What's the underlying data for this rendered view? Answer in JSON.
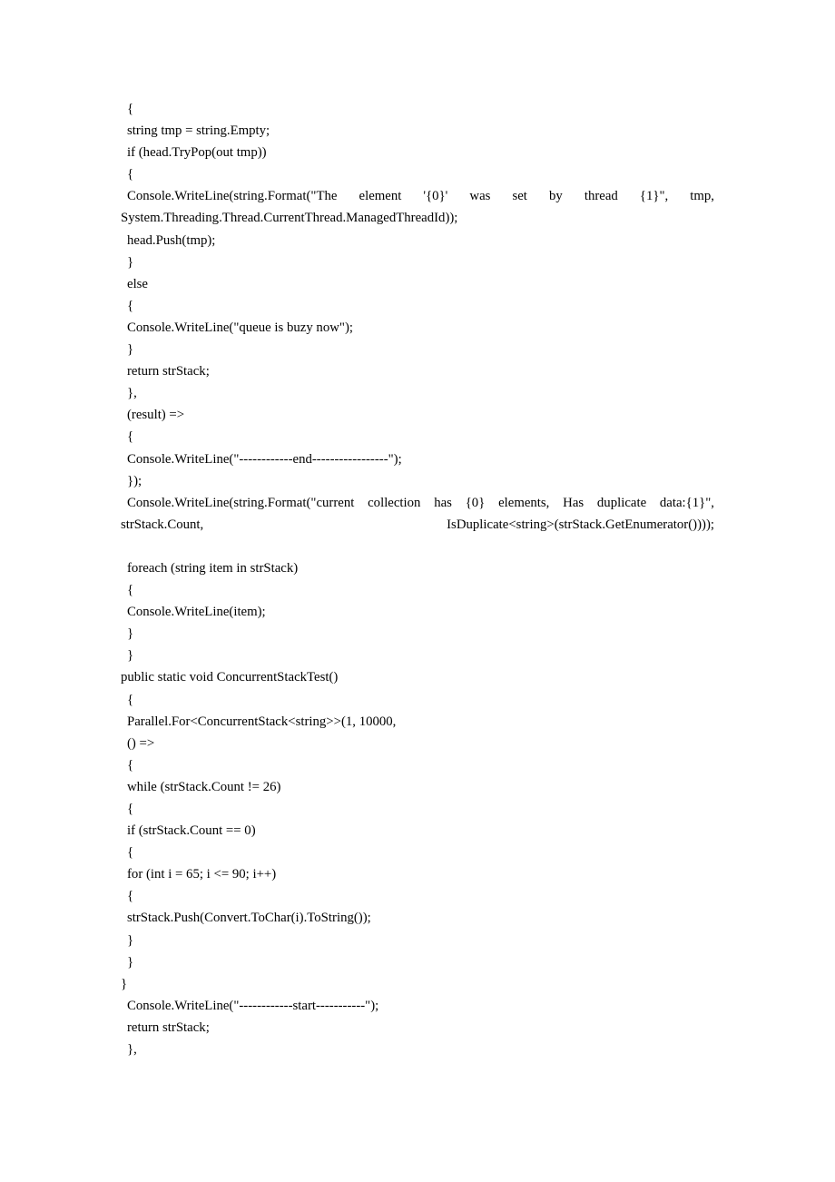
{
  "document": {
    "type": "code-listing",
    "language": "C#",
    "page_background": "#ffffff",
    "text_color": "#000000",
    "lines": [
      {
        "id": "l01",
        "indent": 1,
        "style": "plain",
        "text": "{"
      },
      {
        "id": "l02",
        "indent": 1,
        "style": "plain",
        "text": "string tmp = string.Empty;"
      },
      {
        "id": "l03",
        "indent": 1,
        "style": "plain",
        "text": "if (head.TryPop(out tmp))"
      },
      {
        "id": "l04",
        "indent": 1,
        "style": "plain",
        "text": "{"
      },
      {
        "id": "l05",
        "indent": 1,
        "style": "justify",
        "text": "Console.WriteLine(string.Format(\"The element '{0}' was set by thread {1}\", tmp, System.Threading.Thread.CurrentThread.ManagedThreadId));"
      },
      {
        "id": "l06",
        "indent": 1,
        "style": "plain",
        "text": "head.Push(tmp);"
      },
      {
        "id": "l07",
        "indent": 1,
        "style": "plain",
        "text": "}"
      },
      {
        "id": "l08",
        "indent": 1,
        "style": "plain",
        "text": "else"
      },
      {
        "id": "l09",
        "indent": 1,
        "style": "plain",
        "text": "{"
      },
      {
        "id": "l10",
        "indent": 1,
        "style": "plain",
        "text": "Console.WriteLine(\"queue is buzy now\");"
      },
      {
        "id": "l11",
        "indent": 1,
        "style": "plain",
        "text": "}"
      },
      {
        "id": "l12",
        "indent": 1,
        "style": "plain",
        "text": "return strStack;"
      },
      {
        "id": "l13",
        "indent": 1,
        "style": "plain",
        "text": "},"
      },
      {
        "id": "l14",
        "indent": 1,
        "style": "plain",
        "text": "(result) =>"
      },
      {
        "id": "l15",
        "indent": 1,
        "style": "plain",
        "text": "{"
      },
      {
        "id": "l16",
        "indent": 1,
        "style": "plain",
        "text": "Console.WriteLine(\"------------end-----------------\");"
      },
      {
        "id": "l17",
        "indent": 1,
        "style": "plain",
        "text": "});"
      },
      {
        "id": "l18",
        "indent": 1,
        "style": "justify",
        "text": "Console.WriteLine(string.Format(\"current collection has {0} elements, Has duplicate data:{1}\", strStack.Count, IsDuplicate<string>(strStack.GetEnumerator())));"
      },
      {
        "id": "l19",
        "indent": 0,
        "style": "blank",
        "text": ""
      },
      {
        "id": "l20",
        "indent": 1,
        "style": "plain",
        "text": "foreach (string item in strStack)"
      },
      {
        "id": "l21",
        "indent": 1,
        "style": "plain",
        "text": "{"
      },
      {
        "id": "l22",
        "indent": 1,
        "style": "plain",
        "text": "Console.WriteLine(item);"
      },
      {
        "id": "l23",
        "indent": 1,
        "style": "plain",
        "text": "}"
      },
      {
        "id": "l24",
        "indent": 1,
        "style": "plain",
        "text": "}"
      },
      {
        "id": "l25",
        "indent": 0,
        "style": "plain",
        "text": "public static void ConcurrentStackTest()"
      },
      {
        "id": "l26",
        "indent": 1,
        "style": "plain",
        "text": "{"
      },
      {
        "id": "l27",
        "indent": 1,
        "style": "plain",
        "text": "Parallel.For<ConcurrentStack<string>>(1, 10000,"
      },
      {
        "id": "l28",
        "indent": 1,
        "style": "plain",
        "text": "() =>"
      },
      {
        "id": "l29",
        "indent": 1,
        "style": "plain",
        "text": "{"
      },
      {
        "id": "l30",
        "indent": 1,
        "style": "plain",
        "text": "while (strStack.Count != 26)"
      },
      {
        "id": "l31",
        "indent": 1,
        "style": "plain",
        "text": "{"
      },
      {
        "id": "l32",
        "indent": 1,
        "style": "plain",
        "text": "if (strStack.Count == 0)"
      },
      {
        "id": "l33",
        "indent": 1,
        "style": "plain",
        "text": "{"
      },
      {
        "id": "l34",
        "indent": 1,
        "style": "plain",
        "text": "for (int i = 65; i <= 90; i++)"
      },
      {
        "id": "l35",
        "indent": 1,
        "style": "plain",
        "text": "{"
      },
      {
        "id": "l36",
        "indent": 1,
        "style": "plain",
        "text": "strStack.Push(Convert.ToChar(i).ToString());"
      },
      {
        "id": "l37",
        "indent": 1,
        "style": "plain",
        "text": "}"
      },
      {
        "id": "l38",
        "indent": 1,
        "style": "plain",
        "text": "}"
      },
      {
        "id": "l39",
        "indent": 0,
        "style": "plain",
        "text": "}"
      },
      {
        "id": "l40",
        "indent": 1,
        "style": "plain",
        "text": "Console.WriteLine(\"------------start-----------\");"
      },
      {
        "id": "l41",
        "indent": 1,
        "style": "plain",
        "text": "return strStack;"
      },
      {
        "id": "l42",
        "indent": 1,
        "style": "plain",
        "text": "},"
      }
    ]
  }
}
